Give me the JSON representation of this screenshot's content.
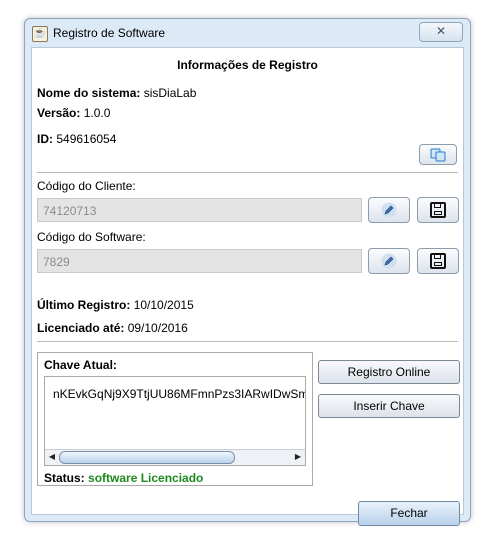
{
  "window": {
    "title": "Registro de Software",
    "close_label": "✕"
  },
  "section_title": "Informações de Registro",
  "system": {
    "name_label": "Nome do sistema:",
    "name_value": "sisDiaLab",
    "version_label": "Versão:",
    "version_value": "1.0.0",
    "id_label": "ID:",
    "id_value": "549616054"
  },
  "client": {
    "label": "Código do Cliente:",
    "value": "74120713"
  },
  "software": {
    "label": "Código do Software:",
    "value": "7829"
  },
  "registration": {
    "last_label": "Último Registro:",
    "last_value": "10/10/2015",
    "licensed_label": "Licenciado até:",
    "licensed_value": "09/10/2016"
  },
  "key": {
    "label": "Chave Atual:",
    "value": "nKEvkGqNj9X9TtjUU86MFmnPzs3IARwIDwSm",
    "status_label": "Status:",
    "status_value": "software Licenciado"
  },
  "buttons": {
    "online": "Registro Online",
    "insert": "Inserir Chave",
    "close": "Fechar"
  },
  "colors": {
    "status_ok": "#1e8a1e",
    "window_frame": "#dce9f6",
    "accent": "#2a78c8"
  }
}
